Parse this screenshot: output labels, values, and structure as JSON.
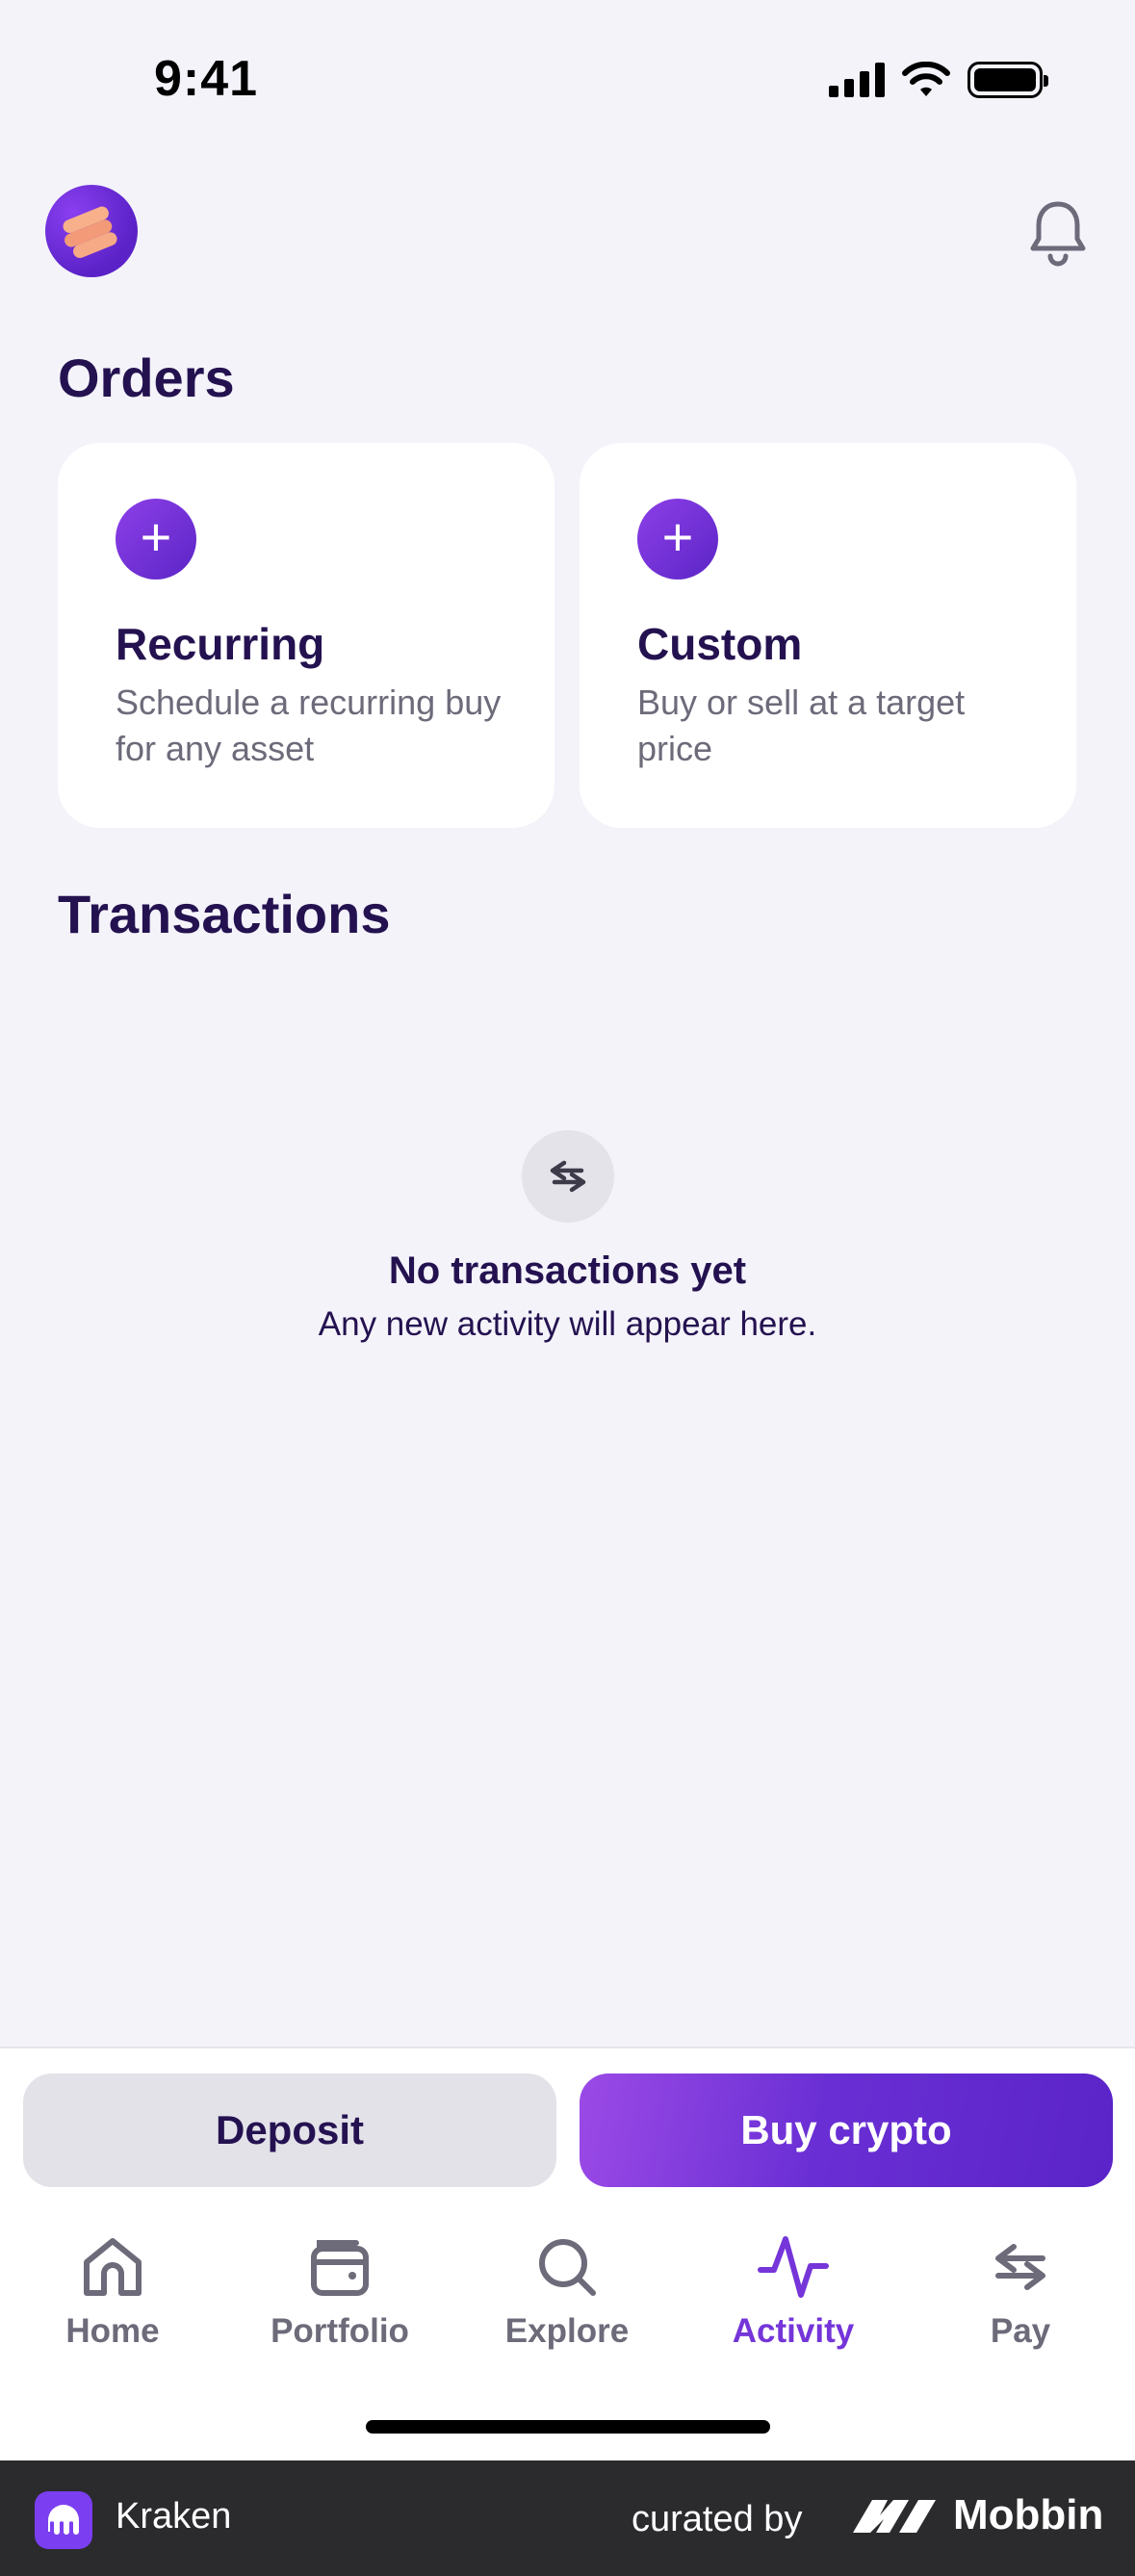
{
  "status_bar": {
    "time": "9:41"
  },
  "orders": {
    "title": "Orders",
    "cards": [
      {
        "title": "Recurring",
        "description": "Schedule a recurring buy for any asset"
      },
      {
        "title": "Custom",
        "description": "Buy or sell at a target price"
      }
    ]
  },
  "transactions": {
    "title": "Transactions",
    "empty_title": "No transactions yet",
    "empty_subtitle": "Any new activity will appear here."
  },
  "actions": {
    "deposit": "Deposit",
    "buy": "Buy crypto"
  },
  "tabs": [
    {
      "label": "Home",
      "icon": "home-icon"
    },
    {
      "label": "Portfolio",
      "icon": "wallet-icon"
    },
    {
      "label": "Explore",
      "icon": "search-icon"
    },
    {
      "label": "Activity",
      "icon": "activity-icon",
      "active": true
    },
    {
      "label": "Pay",
      "icon": "transfer-icon"
    }
  ],
  "footer": {
    "app": "Kraken",
    "curated": "curated by",
    "brand": "Mobbin"
  },
  "colors": {
    "accent": "#7535d9",
    "title": "#241250",
    "background": "#f4f3fa"
  }
}
